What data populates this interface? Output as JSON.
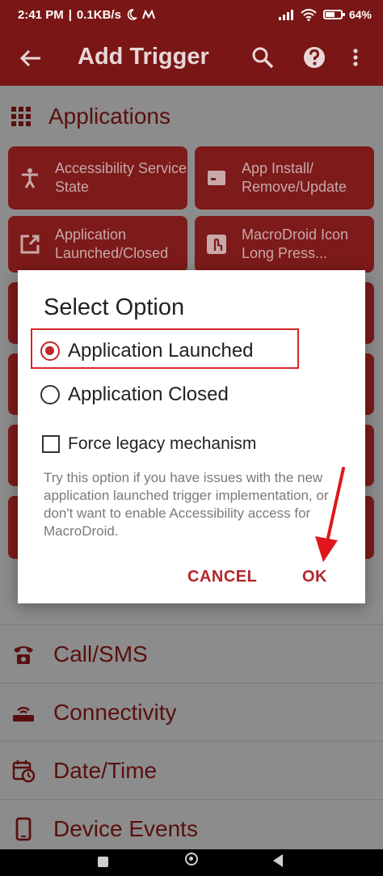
{
  "status_bar": {
    "time": "2:41 PM",
    "separator": "|",
    "speed": "0.1KB/s",
    "battery": "64",
    "battery_level": 0.64
  },
  "toolbar": {
    "title": "Add Trigger"
  },
  "section": {
    "title": "Applications"
  },
  "tiles": [
    {
      "label": "Accessibility Service State"
    },
    {
      "label": "App Install/ Remove/Update"
    },
    {
      "label": "Application Launched/Closed"
    },
    {
      "label": "MacroDroid Icon Long Press..."
    }
  ],
  "categories": [
    {
      "label": "Call/SMS"
    },
    {
      "label": "Connectivity"
    },
    {
      "label": "Date/Time"
    },
    {
      "label": "Device Events"
    }
  ],
  "dialog": {
    "title": "Select Option",
    "options": [
      {
        "label": "Application Launched",
        "selected": true
      },
      {
        "label": "Application Closed",
        "selected": false
      }
    ],
    "checkbox_label": "Force legacy mechanism",
    "checkbox_checked": false,
    "description": "Try this option if you have issues with the new application launched trigger implementation, or don't want to enable Accessibility access for MacroDroid.",
    "cancel_label": "CANCEL",
    "ok_label": "OK"
  },
  "colors": {
    "primary": "#7a1616",
    "accent": "#c0272d",
    "annotation": "#e0161d"
  }
}
